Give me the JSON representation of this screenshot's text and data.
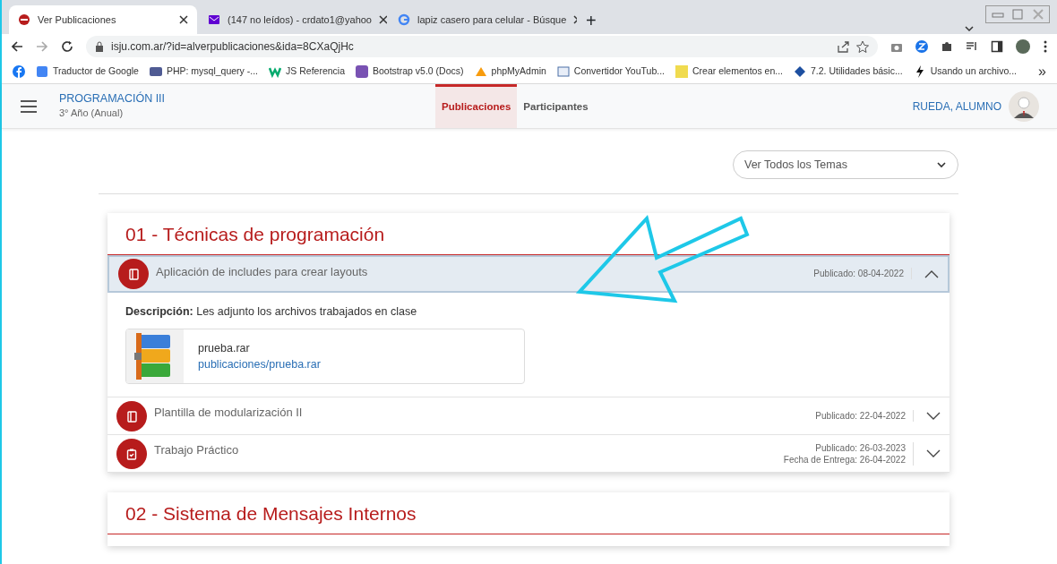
{
  "browser": {
    "tabs": [
      {
        "title": "Ver Publicaciones",
        "selected": true
      },
      {
        "title": "(147 no leídos) - crdato1@yahoo",
        "selected": false
      },
      {
        "title": "lapiz casero para celular - Búsque",
        "selected": false
      }
    ],
    "new_tab": "+",
    "url": "isju.com.ar/?id=alverpublicaciones&ida=8CXaQjHc",
    "bookmarks": [
      "Traductor de Google",
      "PHP: mysql_query -...",
      "JS Referencia",
      "Bootstrap v5.0 (Docs)",
      "phpMyAdmin",
      "Convertidor YouTub...",
      "Crear elementos en...",
      "7.2. Utilidades básic...",
      "Usando un archivo..."
    ],
    "bookmarks_more": "»"
  },
  "header": {
    "course": "PROGRAMACIÓN III",
    "subtitle": "3° Año (Anual)",
    "nav": [
      {
        "label": "Publicaciones",
        "selected": true
      },
      {
        "label": "Participantes",
        "selected": false
      }
    ],
    "user": "RUEDA, ALUMNO"
  },
  "filter": {
    "value": "Ver Todos los Temas"
  },
  "topics": [
    {
      "title": "01 - Técnicas de programación",
      "items": [
        {
          "kind": "note",
          "title": "Aplicación de includes para crear layouts",
          "dates": [
            "Publicado: 08-04-2022"
          ],
          "expanded": true,
          "description_label": "Descripción:",
          "description": "Les adjunto los archivos trabajados en clase",
          "attachment": {
            "name": "prueba.rar",
            "path": "publicaciones/prueba.rar"
          }
        },
        {
          "kind": "note",
          "title": "Plantilla de modularización II",
          "dates": [
            "Publicado: 22-04-2022"
          ],
          "expanded": false
        },
        {
          "kind": "task",
          "title": "Trabajo Práctico",
          "dates": [
            "Publicado: 26-03-2023",
            "Fecha de Entrega: 26-04-2022"
          ],
          "expanded": false
        }
      ]
    },
    {
      "title": "02 - Sistema de Mensajes Internos"
    }
  ]
}
